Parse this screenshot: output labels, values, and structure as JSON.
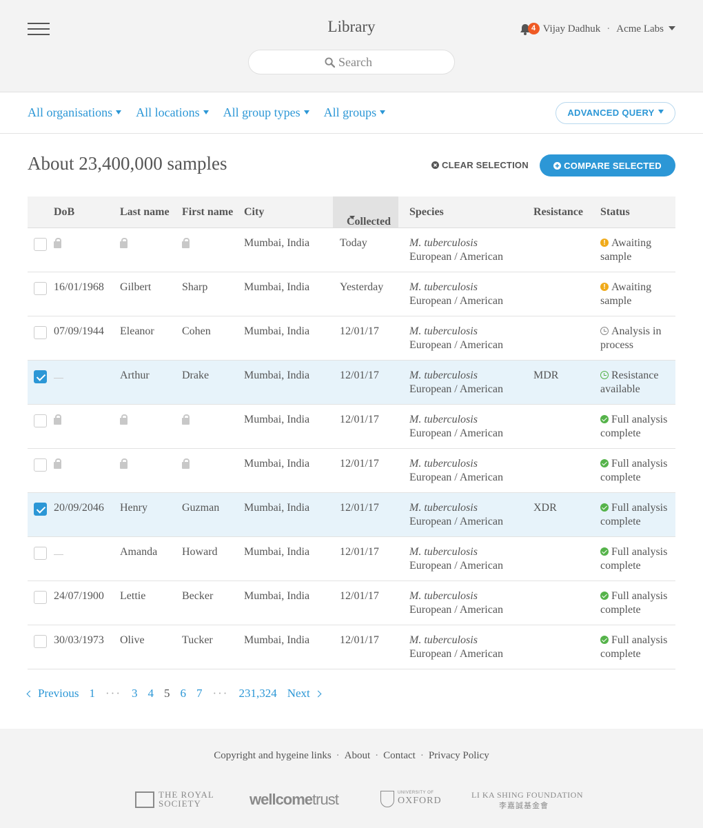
{
  "header": {
    "title": "Library",
    "search_placeholder": "Search",
    "notifications_count": "4",
    "user_name": "Vijay Dadhuk",
    "separator": "·",
    "organisation": "Acme Labs"
  },
  "filters": [
    {
      "label": "All organisations"
    },
    {
      "label": "All locations"
    },
    {
      "label": "All group types"
    },
    {
      "label": "All groups"
    }
  ],
  "advanced_query_label": "ADVANCED QUERY",
  "results": {
    "count_label": "About 23,400,000 samples",
    "clear_selection": "CLEAR SELECTION",
    "compare_selected": "COMPARE SELECTED"
  },
  "table": {
    "columns": {
      "dob": "DoB",
      "last_name": "Last name",
      "first_name": "First name",
      "city": "City",
      "collected": "Collected",
      "species": "Species",
      "resistance": "Resistance",
      "status": "Status"
    },
    "rows": [
      {
        "checked": false,
        "dob": "",
        "last": "",
        "first": "",
        "private": true,
        "city": "Mumbai, India",
        "collected": "Today",
        "species": "M. tuberculosis",
        "lineage": "European / American",
        "resistance": "",
        "status_icon": "warning",
        "status": "Awaiting sample"
      },
      {
        "checked": false,
        "dob": "16/01/1968",
        "last": "Gilbert",
        "first": "Sharp",
        "private": false,
        "city": "Mumbai, India",
        "collected": "Yesterday",
        "species": "M. tuberculosis",
        "lineage": "European / American",
        "resistance": "",
        "status_icon": "warning",
        "status": "Awaiting sample"
      },
      {
        "checked": false,
        "dob": "07/09/1944",
        "last": "Eleanor",
        "first": "Cohen",
        "private": false,
        "city": "Mumbai, India",
        "collected": "12/01/17",
        "species": "M. tuberculosis",
        "lineage": "European / American",
        "resistance": "",
        "status_icon": "clock",
        "status": "Analysis in process"
      },
      {
        "checked": true,
        "dob": "—",
        "last": "Arthur",
        "first": "Drake",
        "private": false,
        "city": "Mumbai, India",
        "collected": "12/01/17",
        "species": "M. tuberculosis",
        "lineage": "European / American",
        "resistance": "MDR",
        "status_icon": "green-clock",
        "status": "Resistance available"
      },
      {
        "checked": false,
        "dob": "",
        "last": "",
        "first": "",
        "private": true,
        "city": "Mumbai, India",
        "collected": "12/01/17",
        "species": "M. tuberculosis",
        "lineage": "European / American",
        "resistance": "",
        "status_icon": "check",
        "status": "Full analysis complete"
      },
      {
        "checked": false,
        "dob": "",
        "last": "",
        "first": "",
        "private": true,
        "city": "Mumbai, India",
        "collected": "12/01/17",
        "species": "M. tuberculosis",
        "lineage": "European / American",
        "resistance": "",
        "status_icon": "check",
        "status": "Full analysis complete"
      },
      {
        "checked": true,
        "dob": "20/09/2046",
        "last": "Henry",
        "first": "Guzman",
        "private": false,
        "city": "Mumbai, India",
        "collected": "12/01/17",
        "species": "M. tuberculosis",
        "lineage": "European / American",
        "resistance": "XDR",
        "status_icon": "check",
        "status": "Full analysis complete"
      },
      {
        "checked": false,
        "dob": "—",
        "last": "Amanda",
        "first": "Howard",
        "private": false,
        "city": "Mumbai, India",
        "collected": "12/01/17",
        "species": "M. tuberculosis",
        "lineage": "European / American",
        "resistance": "",
        "status_icon": "check",
        "status": "Full analysis complete"
      },
      {
        "checked": false,
        "dob": "24/07/1900",
        "last": "Lettie",
        "first": "Becker",
        "private": false,
        "city": "Mumbai, India",
        "collected": "12/01/17",
        "species": "M. tuberculosis",
        "lineage": "European / American",
        "resistance": "",
        "status_icon": "check",
        "status": "Full analysis complete"
      },
      {
        "checked": false,
        "dob": "30/03/1973",
        "last": "Olive",
        "first": "Tucker",
        "private": false,
        "city": "Mumbai, India",
        "collected": "12/01/17",
        "species": "M. tuberculosis",
        "lineage": "European / American",
        "resistance": "",
        "status_icon": "check",
        "status": "Full analysis complete"
      }
    ]
  },
  "pagination": {
    "previous": "Previous",
    "next": "Next",
    "items": [
      "1",
      "···",
      "3",
      "4",
      "5",
      "6",
      "7",
      "···",
      "231,324"
    ],
    "current": "5"
  },
  "footer": {
    "links": [
      "Copyright and hygeine links",
      "About",
      "Contact",
      "Privacy Policy"
    ],
    "separator": "·",
    "logos": {
      "royal_society": "THE ROYAL SOCIETY",
      "wellcome": "wellcome",
      "wellcome_trust": "trust",
      "oxford_small": "UNIVERSITY OF",
      "oxford": "OXFORD",
      "li_ka_shing": "LI KA SHING FOUNDATION",
      "li_ka_shing_cn": "李嘉誠基金會"
    }
  },
  "colors": {
    "accent": "#2c97d6",
    "badge": "#ef5a24",
    "warning": "#f0ab1b",
    "success": "#55b34a",
    "selected_row": "#e7f3fa"
  }
}
